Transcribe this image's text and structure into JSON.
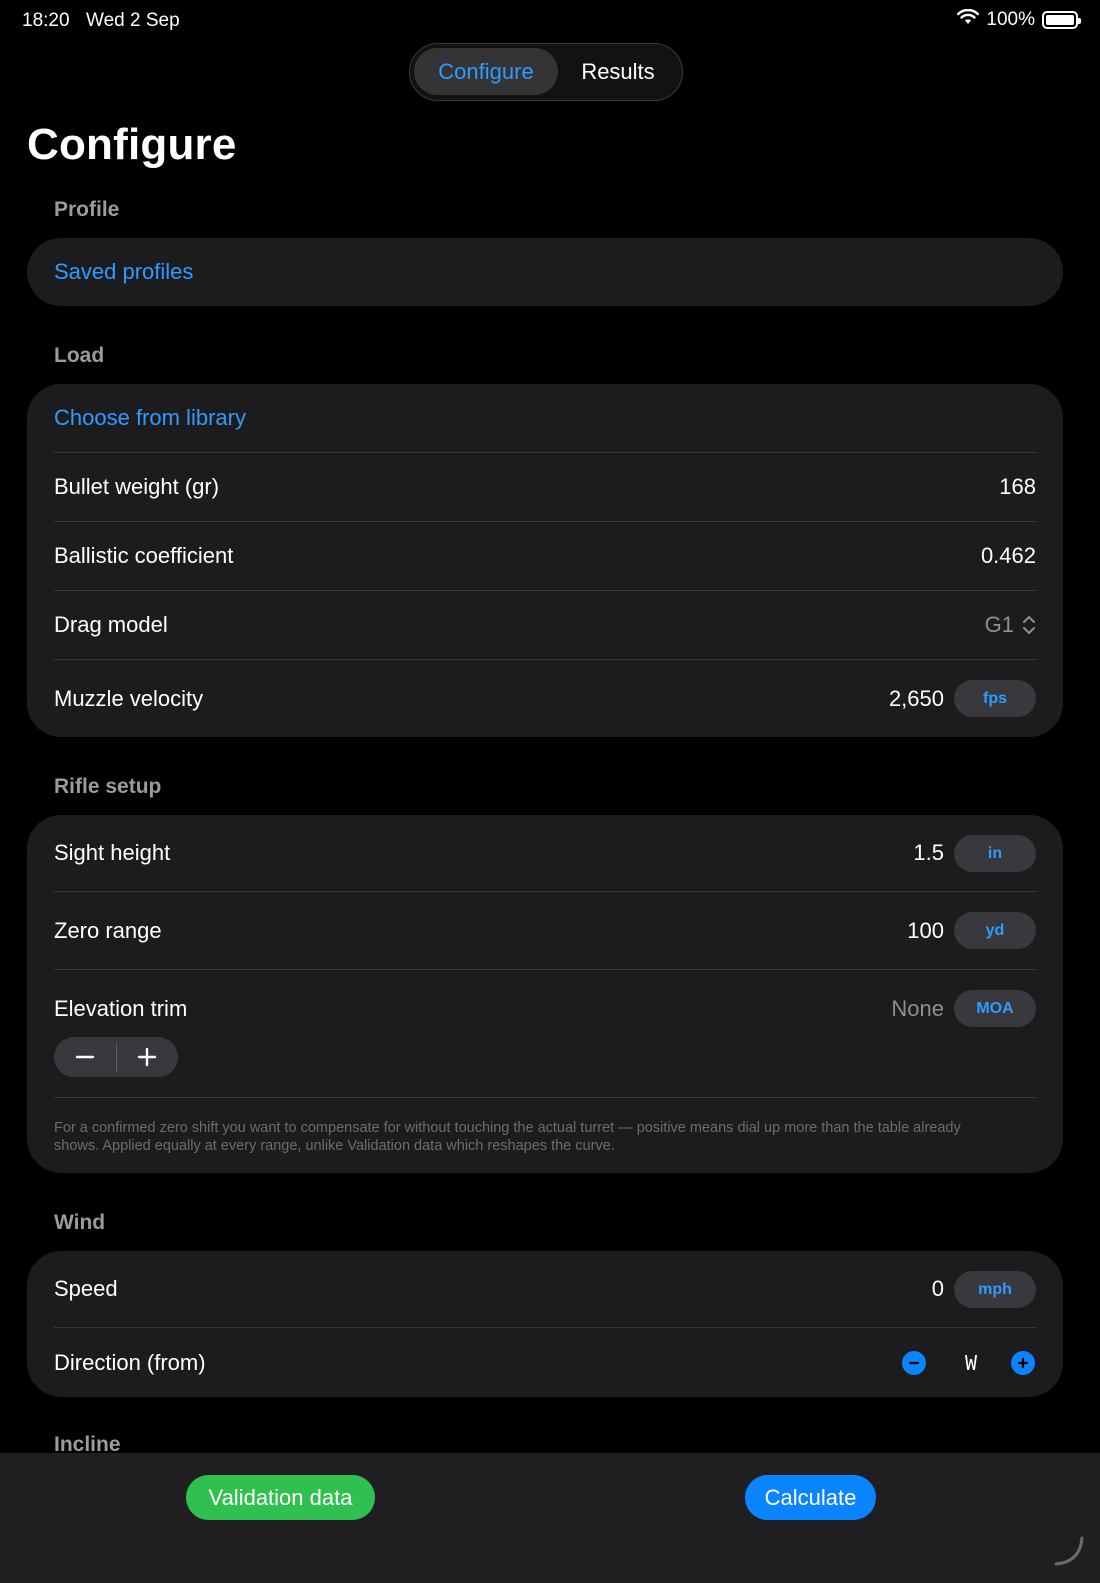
{
  "status_bar": {
    "time": "18:20",
    "date": "Wed 2 Sep",
    "battery": "100%"
  },
  "tabs": {
    "configure": "Configure",
    "results": "Results"
  },
  "page_title": "Configure",
  "profile": {
    "header": "Profile",
    "saved_profiles": "Saved profiles"
  },
  "load": {
    "header": "Load",
    "choose_library": "Choose from library",
    "bullet_weight": {
      "label": "Bullet weight (gr)",
      "value": "168"
    },
    "ballistic_coefficient": {
      "label": "Ballistic coefficient",
      "value": "0.462"
    },
    "drag_model": {
      "label": "Drag model",
      "value": "G1"
    },
    "muzzle_velocity": {
      "label": "Muzzle velocity",
      "value": "2,650",
      "unit": "fps"
    }
  },
  "rifle": {
    "header": "Rifle setup",
    "sight_height": {
      "label": "Sight height",
      "value": "1.5",
      "unit": "in"
    },
    "zero_range": {
      "label": "Zero range",
      "value": "100",
      "unit": "yd"
    },
    "elevation_trim": {
      "label": "Elevation trim",
      "value": "None",
      "unit": "MOA"
    },
    "footnote": "For a confirmed zero shift you want to compensate for without touching the actual turret — positive means dial up more than the table already shows. Applied equally at every range, unlike Validation data which reshapes the curve."
  },
  "wind": {
    "header": "Wind",
    "speed": {
      "label": "Speed",
      "value": "0",
      "unit": "mph"
    },
    "direction": {
      "label": "Direction (from)",
      "value": "W"
    }
  },
  "incline": {
    "header": "Incline"
  },
  "actions": {
    "validation": "Validation data",
    "calculate": "Calculate"
  },
  "colors": {
    "accent": "#0a84ff",
    "green": "#30c04f",
    "card": "#1c1c1e"
  }
}
